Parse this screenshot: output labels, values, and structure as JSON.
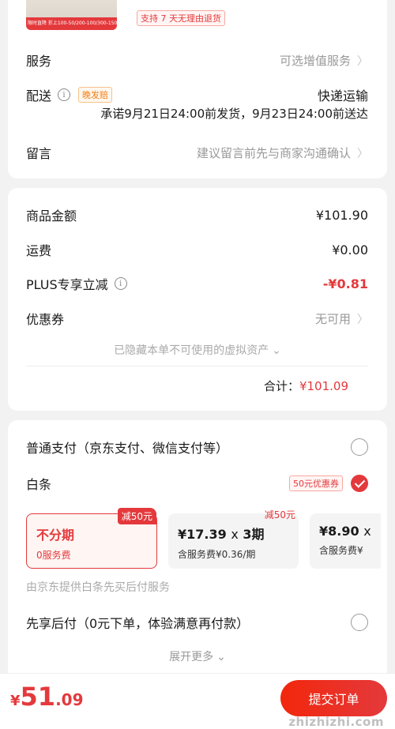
{
  "product": {
    "thumb_line1": "限时直降 折上100-50/200-100/300-150",
    "return_badge": "支持 7 天无理由退货"
  },
  "service": {
    "label": "服务",
    "value": "可选增值服务"
  },
  "delivery": {
    "label": "配送",
    "tag": "晚发赔",
    "method": "快递运输",
    "promise": "承诺9月21日24:00前发货，9月23日24:00前送达"
  },
  "message": {
    "label": "留言",
    "placeholder": "建议留言前先与商家沟通确认"
  },
  "pricing": {
    "goods_label": "商品金额",
    "goods_value": "¥101.90",
    "shipping_label": "运费",
    "shipping_value": "¥0.00",
    "plus_label": "PLUS专享立减",
    "plus_value": "-¥0.81",
    "coupon_label": "优惠券",
    "coupon_value": "无可用",
    "hidden_note": "已隐藏本单不可使用的虚拟资产",
    "total_label": "合计：",
    "total_value": "¥101.09"
  },
  "payment": {
    "normal_label": "普通支付（京东支付、微信支付等）",
    "baitiao_label": "白条",
    "baitiao_coupon": "50元优惠券",
    "plans": [
      {
        "title": "不分期",
        "sub": "0服务费",
        "badge": "减50元"
      },
      {
        "amount": "¥17.39",
        "x": "x",
        "periods": "3期",
        "sub": "含服务费¥0.36/期",
        "badge": "减50元"
      },
      {
        "amount": "¥8.90",
        "x": "x",
        "sub": "含服务费¥"
      }
    ],
    "provider_note": "由京东提供白条先买后付服务",
    "pay_later_label": "先享后付（0元下单，体验满意再付款）",
    "expand_more": "展开更多"
  },
  "footer": {
    "currency": "¥",
    "amount_int": "51",
    "amount_dec": ".09",
    "submit_label": "提交订单",
    "watermark": "zhizhizhi.com"
  },
  "colors": {
    "accent": "#e4393c",
    "background": "#f2f2f2"
  }
}
